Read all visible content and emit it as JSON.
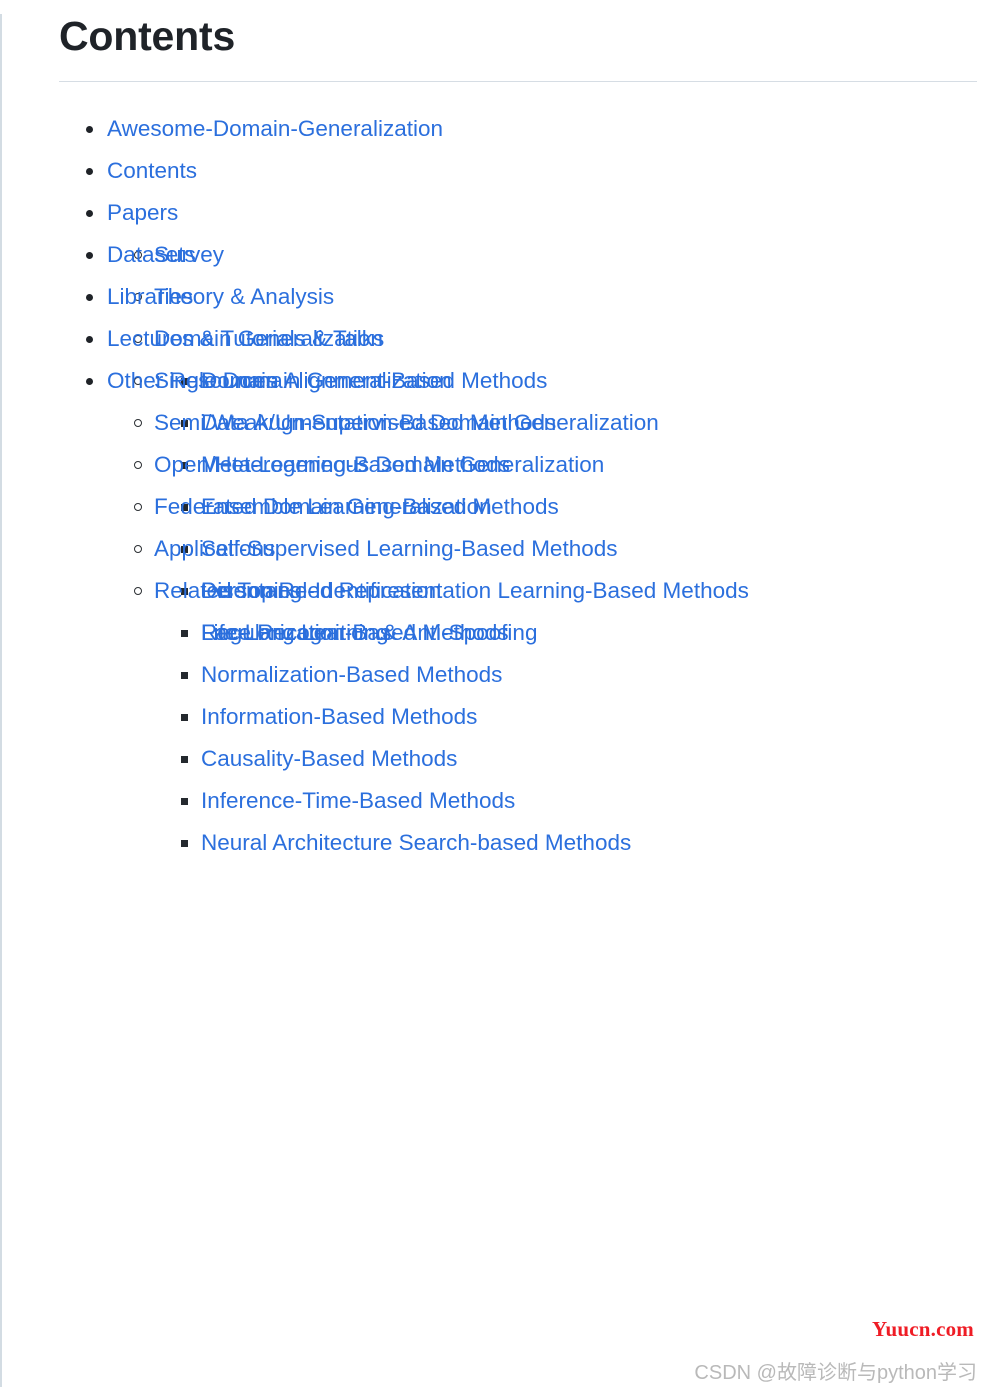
{
  "page": {
    "title": "Contents",
    "link_color": "#2b6fdd",
    "heading_color": "#1f2328",
    "divider_color": "#d6dde4",
    "background": "#ffffff"
  },
  "toc": {
    "items": [
      {
        "label": "Awesome-Domain-Generalization",
        "level": 1
      },
      {
        "label": "Contents",
        "level": 1
      },
      {
        "label": "Papers",
        "level": 1
      },
      {
        "label": "Survey",
        "level": 2
      },
      {
        "label": "Theory & Analysis",
        "level": 2
      },
      {
        "label": "Domain Generalization",
        "level": 2
      },
      {
        "label": "Domain Alignment-Based Methods",
        "level": 3
      },
      {
        "label": "Data Augmentation-Based Methods",
        "level": 3
      },
      {
        "label": "Meta-Learning-Based Methods",
        "level": 3
      },
      {
        "label": "Ensemble Learning-Based Methods",
        "level": 3
      },
      {
        "label": "Self-Supervised Learning-Based Methods",
        "level": 3
      },
      {
        "label": "Disentangled Representation Learning-Based Methods",
        "level": 3
      },
      {
        "label": "Regularization-Based Methods",
        "level": 3
      },
      {
        "label": "Normalization-Based Methods",
        "level": 3
      },
      {
        "label": "Information-Based Methods",
        "level": 3
      },
      {
        "label": "Causality-Based Methods",
        "level": 3
      },
      {
        "label": "Inference-Time-Based Methods",
        "level": 3
      },
      {
        "label": "Neural Architecture Search-based Methods",
        "level": 3
      },
      {
        "label": "Single Domain Generalization",
        "level": 2
      },
      {
        "label": "Semi/Weak/Un-Supervised Domain Generalization",
        "level": 2
      },
      {
        "label": "Open/Heterogeneous Domain Generalization",
        "level": 2
      },
      {
        "label": "Federated Domain Generalization",
        "level": 2
      },
      {
        "label": "Applications",
        "level": 2
      },
      {
        "label": "Person Re-Identification",
        "level": 3
      },
      {
        "label": "Face Recognition & Anti-Spoofing",
        "level": 3
      },
      {
        "label": "Related Topics",
        "level": 2
      },
      {
        "label": "Life-Long Learning",
        "level": 3
      },
      {
        "label": "Datasets",
        "level": 1
      },
      {
        "label": "Libraries",
        "level": 1
      },
      {
        "label": "Lectures & Tutorials & Talks",
        "level": 1
      },
      {
        "label": "Other Resources",
        "level": 1
      }
    ]
  },
  "watermarks": {
    "yuucn": {
      "text": "Yuucn.com",
      "color": "#ef1c25"
    },
    "csdn": {
      "text": "CSDN @故障诊断与python学习",
      "color": "#b9b9b9"
    }
  }
}
